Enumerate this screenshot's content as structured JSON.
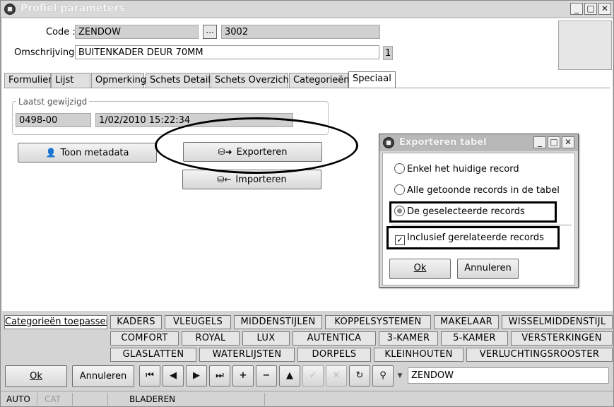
{
  "window": {
    "title": "Profiel parameters",
    "min_icon": "minimize-icon",
    "max_icon": "maximize-icon",
    "close_icon": "close-icon"
  },
  "form": {
    "code_label": "Code :",
    "code_value": "ZENDOW",
    "browse_label": "...",
    "code_number": "3002",
    "omschrijving_label": "Omschrijving :",
    "omschrijving_value": "BUITENKADER DEUR 70MM",
    "omschrijving_index": "1"
  },
  "tabs": [
    {
      "label": "Formulier",
      "active": false
    },
    {
      "label": "Lijst",
      "active": false
    },
    {
      "label": "Opmerking",
      "active": false
    },
    {
      "label": "Schets Detail",
      "active": false
    },
    {
      "label": "Schets Overzicht",
      "active": false
    },
    {
      "label": "Categorieën",
      "active": false
    },
    {
      "label": "Speciaal",
      "active": true
    }
  ],
  "special": {
    "group_title": "Laatst gewijzigd",
    "last_user": "0498-00",
    "last_date": "1/02/2010 15:22:34",
    "metadata_button": "Toon metadata",
    "export_button": "Exporteren",
    "import_button": "Importeren"
  },
  "dialog": {
    "title": "Exporteren tabel",
    "options": [
      {
        "label": "Enkel het huidige record",
        "selected": false
      },
      {
        "label": "Alle getoonde records in de tabel",
        "selected": false
      },
      {
        "label": "De geselecteerde records",
        "selected": true
      }
    ],
    "include_related_label": "Inclusief gerelateerde records",
    "include_related_checked": true,
    "ok_label": "Ok",
    "cancel_label": "Annuleren"
  },
  "categories": {
    "apply_label": "Categorieën toepassen",
    "row1": [
      "KADERS",
      "VLEUGELS",
      "MIDDENSTIJLEN",
      "KOPPELSYSTEMEN",
      "MAKELAAR",
      "WISSELMIDDENSTIJL"
    ],
    "row2": [
      "COMFORT",
      "ROYAL",
      "LUX",
      "AUTENTICA",
      "3-KAMER",
      "5-KAMER",
      "VERSTERKINGEN"
    ],
    "row3": [
      "GLASLATTEN",
      "WATERLIJSTEN",
      "DORPELS",
      "KLEINHOUTEN",
      "VERLUCHTINGSROOSTER"
    ]
  },
  "bottom": {
    "ok_label": "Ok",
    "cancel_label": "Annuleren",
    "search_value": "ZENDOW"
  },
  "status": {
    "mode1": "AUTO",
    "mode2": "CAT",
    "state": "BLADEREN"
  }
}
